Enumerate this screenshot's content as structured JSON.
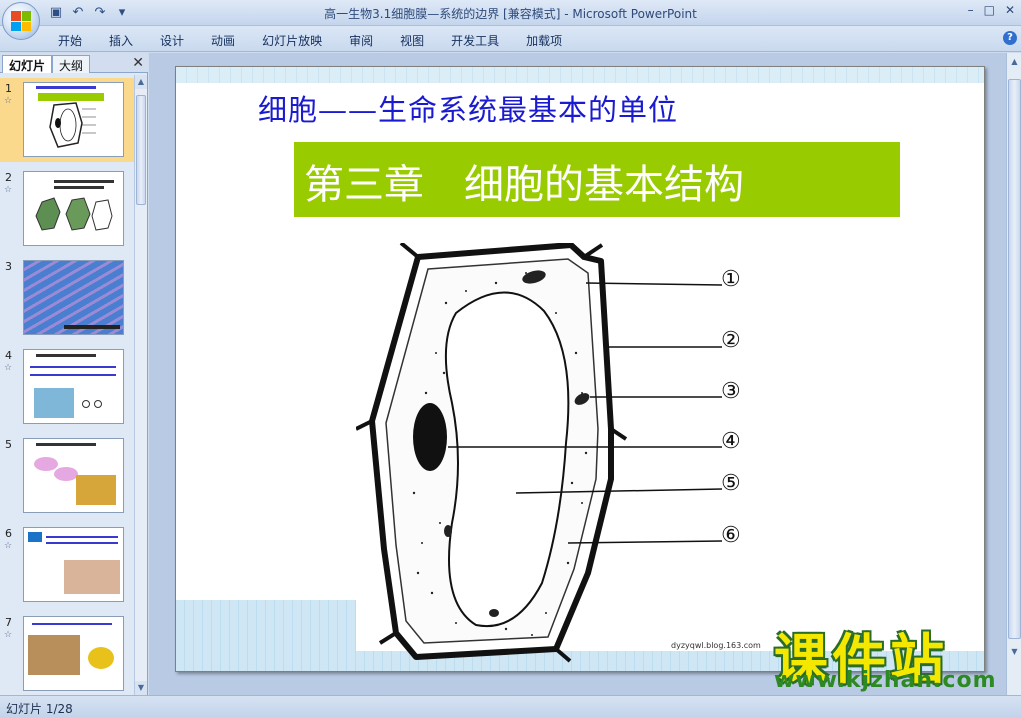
{
  "window": {
    "title": "高一生物3.1细胞膜—系统的边界 [兼容模式] - Microsoft PowerPoint",
    "controls": [
      "–",
      "□",
      "✕"
    ]
  },
  "quick_access": {
    "icons": [
      "save-icon",
      "undo-icon",
      "redo-icon",
      "customize-icon"
    ]
  },
  "ribbon": {
    "tabs": [
      "开始",
      "插入",
      "设计",
      "动画",
      "幻灯片放映",
      "审阅",
      "视图",
      "开发工具",
      "加载项"
    ],
    "help_glyph": "?"
  },
  "left_panel": {
    "tabs": [
      "幻灯片",
      "大纲"
    ],
    "close_glyph": "✕",
    "slides": [
      {
        "num": "1",
        "selected": true
      },
      {
        "num": "2",
        "selected": false
      },
      {
        "num": "3",
        "selected": false
      },
      {
        "num": "4",
        "selected": false
      },
      {
        "num": "5",
        "selected": false
      },
      {
        "num": "6",
        "selected": false
      },
      {
        "num": "7",
        "selected": false
      }
    ]
  },
  "slide": {
    "title": "细胞——生命系统最基本的单位",
    "chapter": "第三章　细胞的基本结构",
    "labels": [
      "①",
      "②",
      "③",
      "④",
      "⑤",
      "⑥"
    ],
    "watermark": "dyzyqwl.blog.163.com",
    "colors": {
      "title": "#1a1ad0",
      "banner": "#99cc00"
    }
  },
  "overlay": {
    "brand": "课件站",
    "url": "www.kjzhan.com"
  },
  "status": {
    "slide_counter": "幻灯片 1/28"
  }
}
